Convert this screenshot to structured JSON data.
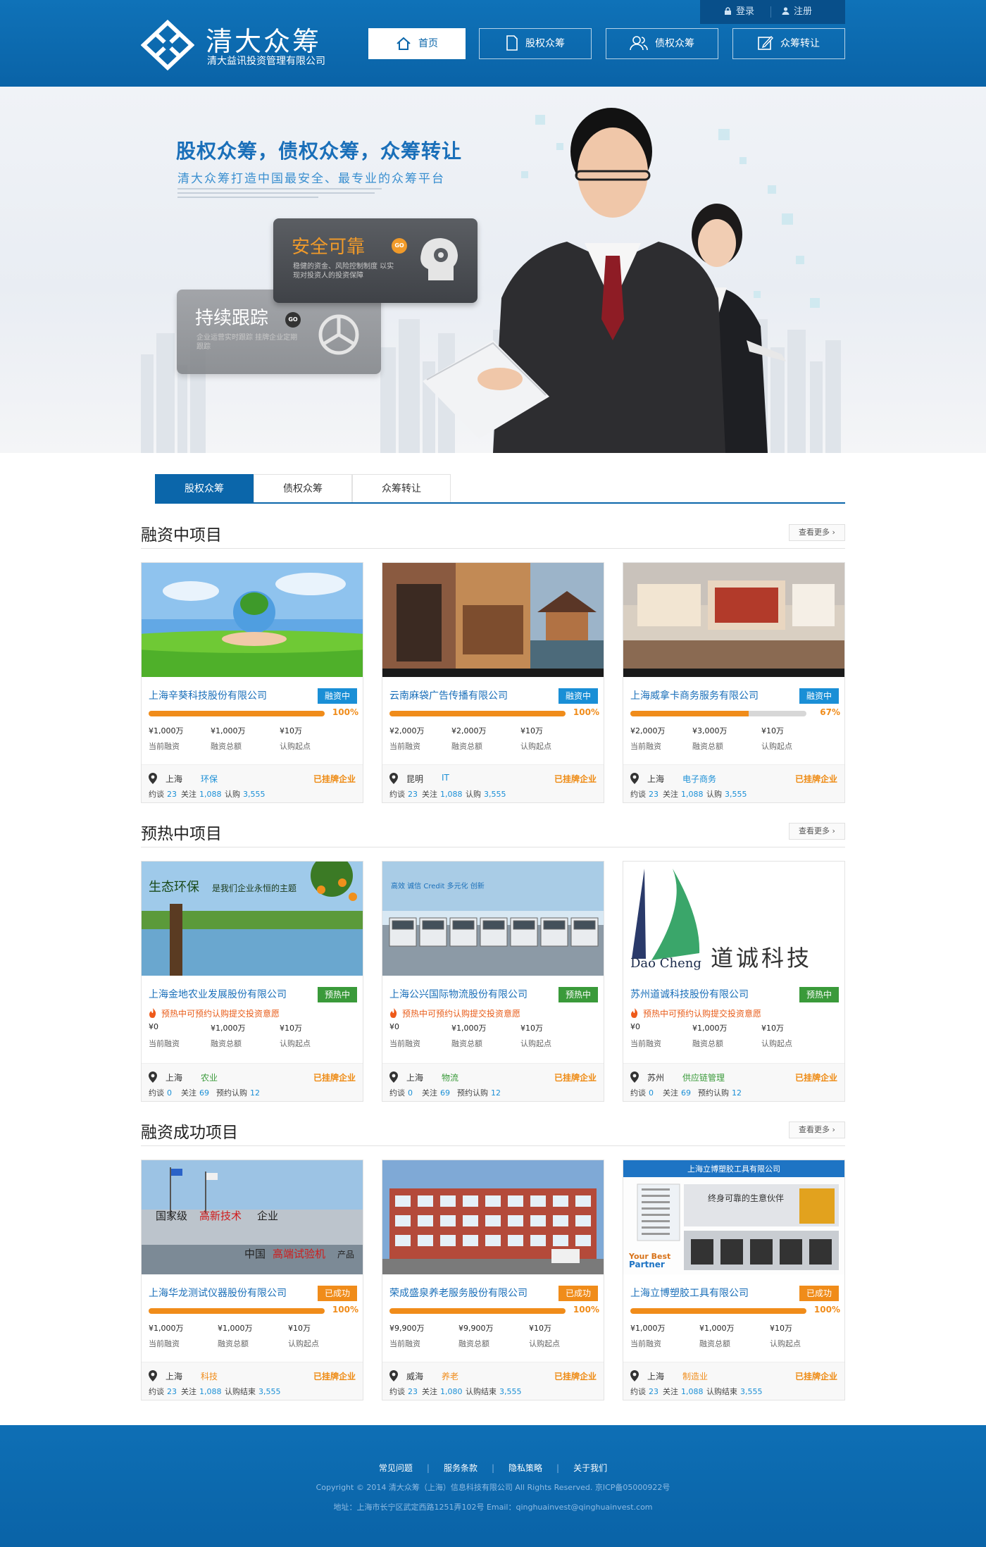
{
  "header": {
    "logo_title": "清大众筹",
    "logo_sub": "清大益讯投资管理有限公司",
    "login": "登录",
    "register": "注册",
    "nav": [
      "首页",
      "股权众筹",
      "债权众筹",
      "众筹转让"
    ]
  },
  "banner": {
    "title": "股权众筹，债权众筹，众筹转让",
    "subtitle": "清大众筹打造中国最安全、最专业的众筹平台",
    "card1_title": "安全可靠",
    "card1_text": "稳健的资金、风险控制制度 以实现对投资人的投资保障",
    "card2_title": "持续跟踪",
    "card2_text": "企业运营实时跟踪 挂牌企业定期跟踪",
    "go": "GO"
  },
  "tabs": [
    "股权众筹",
    "债权众筹",
    "众筹转让"
  ],
  "sections": [
    {
      "title": "融资中项目",
      "more": "查看更多 ›",
      "projects": [
        {
          "name": "上海辛葵科技股份有限公司",
          "badge": "融资中",
          "badge_color": "#1a8fd6",
          "progress": 100,
          "pct": "100%",
          "v1": "¥1,000万",
          "v2": "¥1,000万",
          "v3": "¥10万",
          "l1": "当前融资",
          "l2": "融资总额",
          "l3": "认购起点",
          "city": "上海",
          "industry": "环保",
          "cert": "已挂牌企业",
          "s1": "约谈",
          "n1": "23",
          "s2": "关注",
          "n2": "1,088",
          "s3": "认购",
          "n3": "3,555"
        },
        {
          "name": "云南麻袋广告传播有限公司",
          "badge": "融资中",
          "badge_color": "#1a8fd6",
          "progress": 100,
          "pct": "100%",
          "v1": "¥2,000万",
          "v2": "¥2,000万",
          "v3": "¥10万",
          "l1": "当前融资",
          "l2": "融资总额",
          "l3": "认购起点",
          "city": "昆明",
          "industry": "IT",
          "cert": "已挂牌企业",
          "s1": "约谈",
          "n1": "23",
          "s2": "关注",
          "n2": "1,088",
          "s3": "认购",
          "n3": "3,555"
        },
        {
          "name": "上海威拿卡商务服务有限公司",
          "badge": "融资中",
          "badge_color": "#1a8fd6",
          "progress": 67,
          "pct": "67%",
          "v1": "¥2,000万",
          "v2": "¥3,000万",
          "v3": "¥10万",
          "l1": "当前融资",
          "l2": "融资总额",
          "l3": "认购起点",
          "city": "上海",
          "industry": "电子商务",
          "cert": "已挂牌企业",
          "s1": "约谈",
          "n1": "23",
          "s2": "关注",
          "n2": "1,088",
          "s3": "认购",
          "n3": "3,555"
        }
      ]
    },
    {
      "title": "预热中项目",
      "more": "查看更多 ›",
      "projects": [
        {
          "name": "上海金地农业发展股份有限公司",
          "badge": "预热中",
          "badge_color": "#3a9a3a",
          "note": "预热中可预约认购提交投资意愿",
          "v1": "¥0",
          "v2": "¥1,000万",
          "v3": "¥10万",
          "l1": "当前融资",
          "l2": "融资总额",
          "l3": "认购起点",
          "city": "上海",
          "industry": "农业",
          "cert": "已挂牌企业",
          "s1": "约谈",
          "n1": "0",
          "s2": "关注",
          "n2": "69",
          "s3": "预约认购",
          "n3": "12"
        },
        {
          "name": "上海公兴国际物流股份有限公司",
          "badge": "预热中",
          "badge_color": "#3a9a3a",
          "note": "预热中可预约认购提交投资意愿",
          "v1": "¥0",
          "v2": "¥1,000万",
          "v3": "¥10万",
          "l1": "当前融资",
          "l2": "融资总额",
          "l3": "认购起点",
          "city": "上海",
          "industry": "物流",
          "cert": "已挂牌企业",
          "s1": "约谈",
          "n1": "0",
          "s2": "关注",
          "n2": "69",
          "s3": "预约认购",
          "n3": "12"
        },
        {
          "name": "苏州道诚科技股份有限公司",
          "badge": "预热中",
          "badge_color": "#3a9a3a",
          "note": "预热中可预约认购提交投资意愿",
          "v1": "¥0",
          "v2": "¥1,000万",
          "v3": "¥10万",
          "l1": "当前融资",
          "l2": "融资总额",
          "l3": "认购起点",
          "city": "苏州",
          "industry": "供应链管理",
          "cert": "已挂牌企业",
          "s1": "约谈",
          "n1": "0",
          "s2": "关注",
          "n2": "69",
          "s3": "预约认购",
          "n3": "12"
        }
      ]
    },
    {
      "title": "融资成功项目",
      "more": "查看更多 ›",
      "projects": [
        {
          "name": "上海华龙测试仪器股份有限公司",
          "badge": "已成功",
          "badge_color": "#f08c1a",
          "progress": 100,
          "pct": "100%",
          "v1": "¥1,000万",
          "v2": "¥1,000万",
          "v3": "¥10万",
          "l1": "当前融资",
          "l2": "融资总额",
          "l3": "认购起点",
          "city": "上海",
          "industry": "科技",
          "cert": "已挂牌企业",
          "s1": "约谈",
          "n1": "23",
          "s2": "关注",
          "n2": "1,088",
          "s3": "认购结束",
          "n3": "3,555"
        },
        {
          "name": "荣成盛泉养老服务股份有限公司",
          "badge": "已成功",
          "badge_color": "#f08c1a",
          "progress": 100,
          "pct": "100%",
          "v1": "¥9,900万",
          "v2": "¥9,900万",
          "v3": "¥10万",
          "l1": "当前融资",
          "l2": "融资总额",
          "l3": "认购起点",
          "city": "威海",
          "industry": "养老",
          "cert": "已挂牌企业",
          "s1": "约谈",
          "n1": "23",
          "s2": "关注",
          "n2": "1,080",
          "s3": "认购结束",
          "n3": "3,555"
        },
        {
          "name": "上海立博塑胶工具有限公司",
          "badge": "已成功",
          "badge_color": "#f08c1a",
          "progress": 100,
          "pct": "100%",
          "v1": "¥1,000万",
          "v2": "¥1,000万",
          "v3": "¥10万",
          "l1": "当前融资",
          "l2": "融资总额",
          "l3": "认购起点",
          "city": "上海",
          "industry": "制造业",
          "cert": "已挂牌企业",
          "s1": "约谈",
          "n1": "23",
          "s2": "关注",
          "n2": "1,088",
          "s3": "认购结束",
          "n3": "3,555"
        }
      ]
    }
  ],
  "images": {
    "img_0_1_text1": "生态环保",
    "img_0_1_text2": "是我们企业永恒的主题",
    "img_1_1_text": "高效 诚信 Credit 多元化 创新",
    "img_2_1_text": "Dao Cheng",
    "img_2_1_text2": "道诚科技",
    "img_0_2_text1": "国家级",
    "img_0_2_text2": "高新技术",
    "img_0_2_text3": "企业",
    "img_0_2_text4": "中国",
    "img_0_2_text5": "高端试验机",
    "img_0_2_text6": "产品",
    "img_2_2_head": "上海立博塑胶工具有限公司",
    "img_2_2_slogan": "终身可靠的生意伙伴",
    "img_2_2_partner": "Your Best Partner"
  },
  "footer": {
    "links": [
      "常见问题",
      "服务条款",
      "隐私策略",
      "关于我们"
    ],
    "copyright": "Copyright © 2014 清大众筹（上海）信息科技有限公司 All Rights Reserved. 京ICP备05000922号",
    "address": "地址：上海市长宁区武定西路1251弄102号  Email：qinghuainvest@qinghuainvest.com"
  },
  "colors": {
    "brand_blue": "#0b66aa",
    "accent_orange": "#f08c1a",
    "preheat_green": "#3a9a3a"
  }
}
